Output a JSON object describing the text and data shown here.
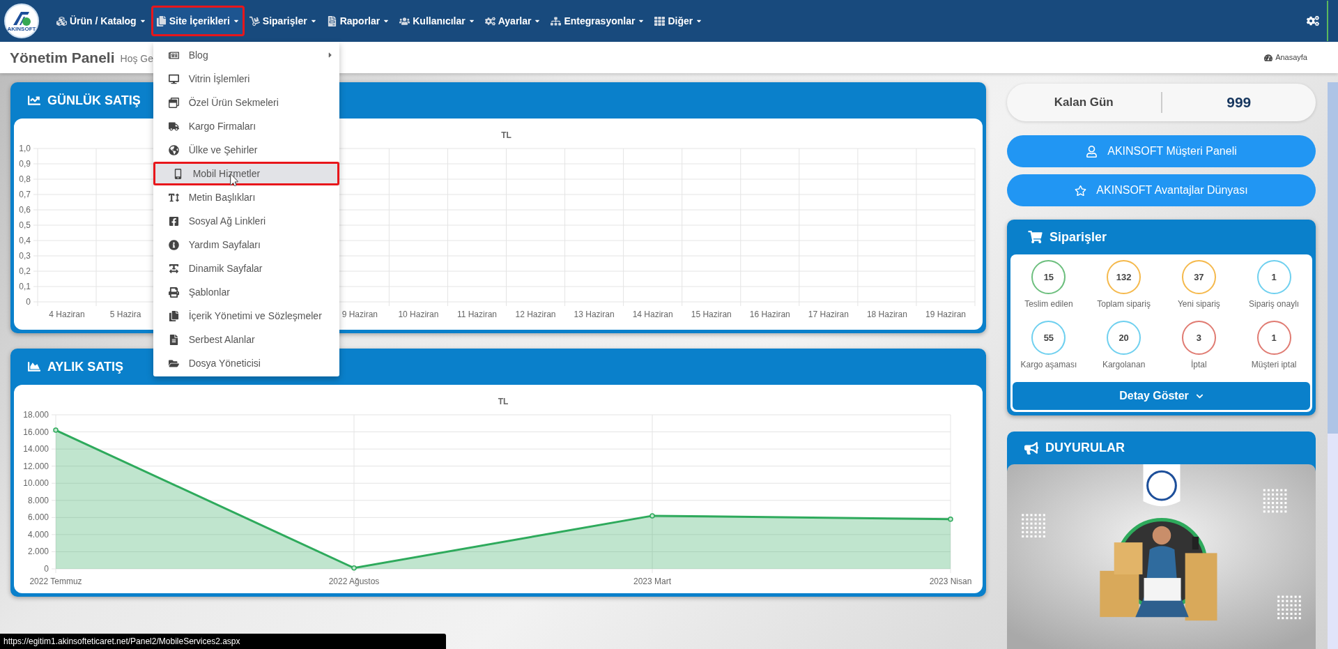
{
  "logo_text": "AKINSOFT",
  "nav": {
    "items": [
      {
        "label": "Ürün / Katalog",
        "expanded": false,
        "highlighted": false
      },
      {
        "label": "Site İçerikleri",
        "expanded": true,
        "highlighted": true,
        "menu": [
          {
            "label": "Blog",
            "submenu": true,
            "selected": false,
            "highlighted": false
          },
          {
            "label": "Vitrin İşlemleri",
            "submenu": false,
            "selected": false,
            "highlighted": false
          },
          {
            "label": "Özel Ürün Sekmeleri",
            "submenu": false,
            "selected": false,
            "highlighted": false
          },
          {
            "label": "Kargo Firmaları",
            "submenu": false,
            "selected": false,
            "highlighted": false
          },
          {
            "label": "Ülke ve Şehirler",
            "submenu": false,
            "selected": false,
            "highlighted": false
          },
          {
            "label": "Mobil Hizmetler",
            "submenu": false,
            "selected": true,
            "highlighted": true
          },
          {
            "label": "Metin Başlıkları",
            "submenu": false,
            "selected": false,
            "highlighted": false
          },
          {
            "label": "Sosyal Ağ Linkleri",
            "submenu": false,
            "selected": false,
            "highlighted": false
          },
          {
            "label": "Yardım Sayfaları",
            "submenu": false,
            "selected": false,
            "highlighted": false
          },
          {
            "label": "Dinamik Sayfalar",
            "submenu": false,
            "selected": false,
            "highlighted": false
          },
          {
            "label": "Şablonlar",
            "submenu": false,
            "selected": false,
            "highlighted": false
          },
          {
            "label": "İçerik Yönetimi ve Sözleşmeler",
            "submenu": false,
            "selected": false,
            "highlighted": false
          },
          {
            "label": "Serbest Alanlar",
            "submenu": false,
            "selected": false,
            "highlighted": false
          },
          {
            "label": "Dosya Yöneticisi",
            "submenu": false,
            "selected": false,
            "highlighted": false
          }
        ]
      },
      {
        "label": "Siparişler",
        "expanded": false,
        "highlighted": false
      },
      {
        "label": "Raporlar",
        "expanded": false,
        "highlighted": false
      },
      {
        "label": "Kullanıcılar",
        "expanded": false,
        "highlighted": false
      },
      {
        "label": "Ayarlar",
        "expanded": false,
        "highlighted": false
      },
      {
        "label": "Entegrasyonlar",
        "expanded": false,
        "highlighted": false
      },
      {
        "label": "Diğer",
        "expanded": false,
        "highlighted": false
      }
    ]
  },
  "header": {
    "title": "Yönetim Paneli",
    "subtitle": "Hoş Ge",
    "breadcrumb": "Anasayfa"
  },
  "daily_sales": {
    "title": "GÜNLÜK SATIŞ",
    "chart_data": {
      "type": "bar",
      "grid": true,
      "categories": [
        "4 Haziran",
        "5 Hazira",
        null,
        null,
        null,
        "9 Haziran",
        "10 Haziran",
        "11 Haziran",
        "12 Haziran",
        "13 Haziran",
        "14 Haziran",
        "15 Haziran",
        "16 Haziran",
        "17 Haziran",
        "18 Haziran",
        "19 Haziran"
      ],
      "series": [
        {
          "name": "TL",
          "values": [
            null,
            null,
            null,
            null,
            null,
            null,
            null,
            null,
            null,
            null,
            null,
            null,
            null,
            null,
            null,
            null
          ]
        }
      ],
      "ylim": [
        0,
        1
      ],
      "yticks": [
        {
          "value": 0,
          "label": "0"
        },
        {
          "value": 0.1,
          "label": "0,1"
        },
        {
          "value": 0.2,
          "label": "0,2"
        },
        {
          "value": 0.3,
          "label": "0,3"
        },
        {
          "value": 0.4,
          "label": "0,4"
        },
        {
          "value": 0.5,
          "label": "0,5"
        },
        {
          "value": 0.6,
          "label": "0,6"
        },
        {
          "value": 0.7,
          "label": "0,7"
        },
        {
          "value": 0.8,
          "label": "0,8"
        },
        {
          "value": 0.9,
          "label": "0,9"
        },
        {
          "value": 1,
          "label": "1,0"
        }
      ]
    }
  },
  "monthly_sales": {
    "title": "AYLIK SATIŞ",
    "chart_data": {
      "type": "area",
      "grid": true,
      "categories": [
        "2022 Temmuz",
        "2022 Ağustos",
        "2023 Mart",
        "2023 Nisan"
      ],
      "series": [
        {
          "name": "TL",
          "color": "#2eaa5c",
          "values": [
            16200,
            100,
            6200,
            5800
          ]
        }
      ],
      "ylim": [
        0,
        18000
      ],
      "yticks": [
        {
          "value": 0,
          "label": "0"
        },
        {
          "value": 2000,
          "label": "2.000"
        },
        {
          "value": 4000,
          "label": "4.000"
        },
        {
          "value": 6000,
          "label": "6.000"
        },
        {
          "value": 8000,
          "label": "8.000"
        },
        {
          "value": 10000,
          "label": "10.000"
        },
        {
          "value": 12000,
          "label": "12.000"
        },
        {
          "value": 14000,
          "label": "14.000"
        },
        {
          "value": 16000,
          "label": "16.000"
        },
        {
          "value": 18000,
          "label": "18.000"
        }
      ]
    }
  },
  "remaining_days": {
    "label": "Kalan Gün",
    "value": "999"
  },
  "links": [
    {
      "kind": "user",
      "label": "AKINSOFT Müşteri Paneli"
    },
    {
      "kind": "star",
      "label": "AKINSOFT Avantajlar Dünyası"
    }
  ],
  "orders": {
    "title": "Siparişler",
    "stats": [
      {
        "value": "15",
        "label": "Teslim edilen",
        "color": "#6dbf7e"
      },
      {
        "value": "132",
        "label": "Toplam sipariş",
        "color": "#f5b94c"
      },
      {
        "value": "37",
        "label": "Yeni sipariş",
        "color": "#f5b94c"
      },
      {
        "value": "1",
        "label": "Sipariş onaylı",
        "color": "#6fd0ef"
      },
      {
        "value": "55",
        "label": "Kargo aşaması",
        "color": "#6fd0ef"
      },
      {
        "value": "20",
        "label": "Kargolanan",
        "color": "#6fd0ef"
      },
      {
        "value": "3",
        "label": "İptal",
        "color": "#e07b72"
      },
      {
        "value": "1",
        "label": "Müşteri iptal",
        "color": "#e07b72"
      }
    ],
    "button": "Detay Göster"
  },
  "announcements": {
    "title": "DUYURULAR"
  },
  "status_bar": {
    "url": "https://egitim1.akinsofteticaret.net/Panel2/MobileServices2.aspx"
  }
}
